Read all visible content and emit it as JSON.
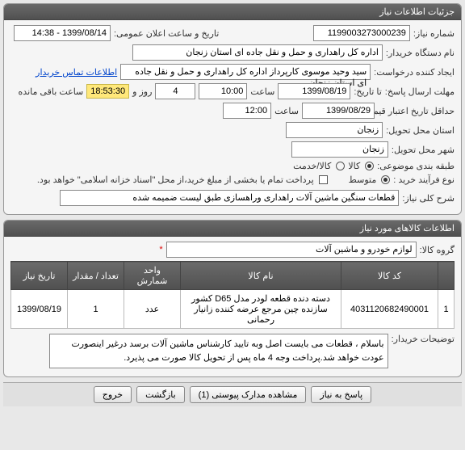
{
  "panel1": {
    "title": "جزئیات اطلاعات نیاز",
    "need_no_label": "شماره نیاز:",
    "need_no_value": "1199003273000239",
    "announce_date_label": "تاریخ و ساعت اعلان عمومی:",
    "announce_date_value": "1399/08/14 - 14:38",
    "buyer_org_label": "نام دستگاه خریدار:",
    "buyer_org_value": "اداره کل راهداری و حمل و نقل جاده ای استان زنجان",
    "creator_label": "ایجاد کننده درخواست:",
    "creator_value": "سید وحید موسوی کارپرداز اداره کل راهداری و حمل و نقل جاده ای استان زنجان",
    "contact_link": "اطلاعات تماس خریدار",
    "reply_deadline_label": "مهلت ارسال پاسخ:",
    "reply_until_label": "تا تاریخ:",
    "reply_date": "1399/08/19",
    "reply_time_label": "ساعت",
    "reply_time": "10:00",
    "days_box": "4",
    "days_label": "روز و",
    "remain_time": "18:53:30",
    "remain_label": "ساعت باقی مانده",
    "valid_deadline_label": "حداقل تاریخ اعتبار قیمت: تا تاریخ:",
    "valid_date": "1399/08/29",
    "valid_time_label": "ساعت",
    "valid_time": "12:00",
    "delivery_state_label": "استان محل تحویل:",
    "delivery_state": "زنجان",
    "delivery_city_label": "شهر محل تحویل:",
    "delivery_city": "زنجان",
    "budget_label": "طبقه بندی موضوعی:",
    "budget_kala": "کالا",
    "budget_service": "کالا/خدمت",
    "process_label": "نوع فرآیند خرید :",
    "process_medium": "متوسط",
    "partial_pay_label": "پرداخت تمام یا بخشی از مبلغ خرید،از محل \"اسناد خزانه اسلامی\" خواهد بود.",
    "summary_label": "شرح کلی نیاز:",
    "summary_value": "قطعات سنگین ماشین آلات راهداری وراهسازی طبق لیست ضمیمه شده"
  },
  "panel2": {
    "title": "اطلاعات کالاهای مورد نیاز",
    "group_label": "گروه کالا:",
    "group_value": "لوازم خودرو و ماشین آلات",
    "asterisk": "*",
    "hdr": {
      "idx": "",
      "code": "کد کالا",
      "name": "نام کالا",
      "unit": "واحد شمارش",
      "qty": "تعداد / مقدار",
      "date": "تاریخ نیاز"
    },
    "rows": [
      {
        "idx": "1",
        "code": "4031120682490001",
        "name": "دسته دنده قطعه لودر مدل D65 کشور سازنده چین مرجع عرضه کننده زانیار رحمانی",
        "unit": "عدد",
        "qty": "1",
        "date": "1399/08/19"
      }
    ],
    "buyer_notes_label": "توضیحات خریدار:",
    "buyer_notes_value": "باسلام ، قطعات می بایست اصل وبه تایید کارشناس ماشین آلات برسد درغیر اینصورت عودت خواهد شد.پرداخت وجه 4 ماه پس از تحویل کالا صورت می پذیرد."
  },
  "footer": {
    "reply": "پاسخ به نیاز",
    "docs": "مشاهده مدارک پیوستی (1)",
    "back": "بازگشت",
    "exit": "خروج"
  }
}
